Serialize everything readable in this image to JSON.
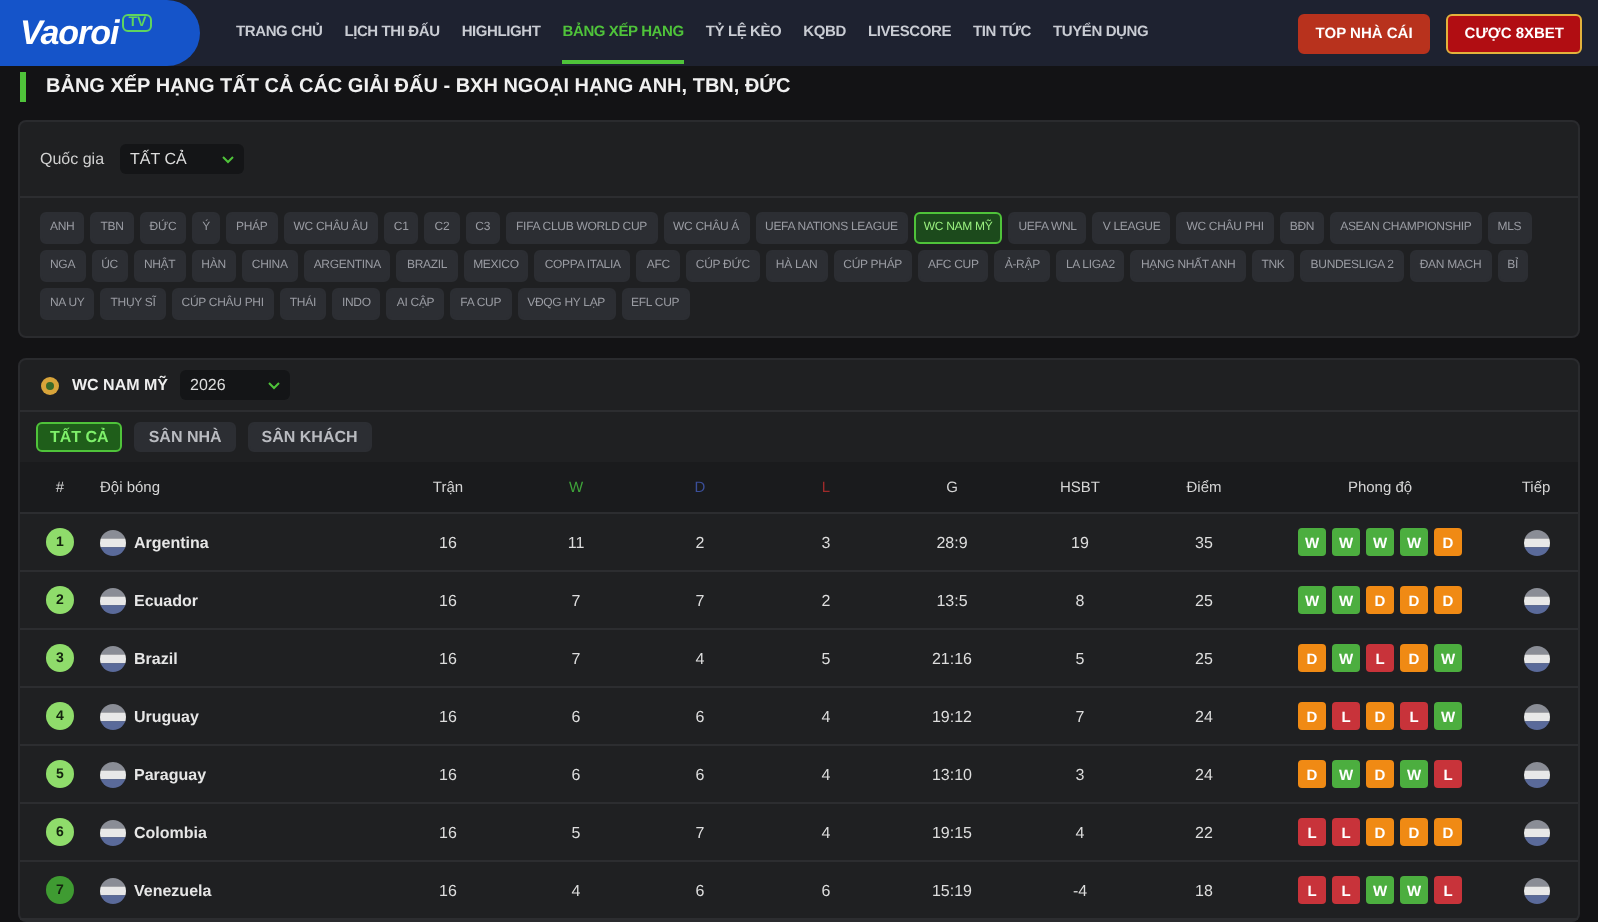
{
  "header": {
    "logo": {
      "text": "Vaoroi",
      "badge": "TV"
    },
    "nav": [
      {
        "label": "TRANG CHỦ",
        "selected": false
      },
      {
        "label": "LỊCH THI ĐẤU",
        "selected": false
      },
      {
        "label": "HIGHLIGHT",
        "selected": false
      },
      {
        "label": "BẢNG XẾP HẠNG",
        "selected": true
      },
      {
        "label": "TỶ LỆ KÈO",
        "selected": false
      },
      {
        "label": "KQBD",
        "selected": false
      },
      {
        "label": "LIVESCORE",
        "selected": false
      },
      {
        "label": "TIN TỨC",
        "selected": false
      },
      {
        "label": "TUYỂN DỤNG",
        "selected": false
      }
    ],
    "buttons": [
      {
        "label": "TOP NHÀ CÁI",
        "kind": "plain"
      },
      {
        "label": "CƯỢC 8XBET",
        "kind": "outlined"
      }
    ]
  },
  "page_title": "BẢNG XẾP HẠNG TẤT CẢ CÁC GIẢI ĐẤU - BXH NGOẠI HẠNG ANH, TBN, ĐỨC",
  "filter": {
    "country_label": "Quốc gia",
    "country_value": "TẤT CẢ",
    "leagues": [
      {
        "label": "ANH",
        "selected": false
      },
      {
        "label": "TBN",
        "selected": false
      },
      {
        "label": "ĐỨC",
        "selected": false
      },
      {
        "label": "Ý",
        "selected": false
      },
      {
        "label": "PHÁP",
        "selected": false
      },
      {
        "label": "WC CHÂU ÂU",
        "selected": false
      },
      {
        "label": "C1",
        "selected": false
      },
      {
        "label": "C2",
        "selected": false
      },
      {
        "label": "C3",
        "selected": false
      },
      {
        "label": "FIFA CLUB WORLD CUP",
        "selected": false
      },
      {
        "label": "WC CHÂU Á",
        "selected": false
      },
      {
        "label": "UEFA NATIONS LEAGUE",
        "selected": false
      },
      {
        "label": "WC NAM MỸ",
        "selected": true
      },
      {
        "label": "UEFA WNL",
        "selected": false
      },
      {
        "label": "V LEAGUE",
        "selected": false
      },
      {
        "label": "WC CHÂU PHI",
        "selected": false
      },
      {
        "label": "BĐN",
        "selected": false
      },
      {
        "label": "ASEAN CHAMPIONSHIP",
        "selected": false
      },
      {
        "label": "MLS",
        "selected": false
      },
      {
        "label": "NGA",
        "selected": false
      },
      {
        "label": "ÚC",
        "selected": false
      },
      {
        "label": "NHẬT",
        "selected": false
      },
      {
        "label": "HÀN",
        "selected": false
      },
      {
        "label": "CHINA",
        "selected": false
      },
      {
        "label": "ARGENTINA",
        "selected": false
      },
      {
        "label": "BRAZIL",
        "selected": false
      },
      {
        "label": "MEXICO",
        "selected": false
      },
      {
        "label": "COPPA ITALIA",
        "selected": false
      },
      {
        "label": "AFC",
        "selected": false
      },
      {
        "label": "CÚP ĐỨC",
        "selected": false
      },
      {
        "label": "HÀ LAN",
        "selected": false
      },
      {
        "label": "CÚP PHÁP",
        "selected": false
      },
      {
        "label": "AFC CUP",
        "selected": false
      },
      {
        "label": "Ả-RẬP",
        "selected": false
      },
      {
        "label": "LA LIGA2",
        "selected": false
      },
      {
        "label": "HẠNG NHẤT ANH",
        "selected": false
      },
      {
        "label": "TNK",
        "selected": false
      },
      {
        "label": "BUNDESLIGA 2",
        "selected": false
      },
      {
        "label": "ĐAN MẠCH",
        "selected": false
      },
      {
        "label": "BỈ",
        "selected": false
      },
      {
        "label": "NA UY",
        "selected": false
      },
      {
        "label": "THỤY SĨ",
        "selected": false
      },
      {
        "label": "CÚP CHÂU PHI",
        "selected": false
      },
      {
        "label": "THÁI",
        "selected": false
      },
      {
        "label": "INDO",
        "selected": false
      },
      {
        "label": "AI CẬP",
        "selected": false
      },
      {
        "label": "FA CUP",
        "selected": false
      },
      {
        "label": "VĐQG HY LẠP",
        "selected": false
      },
      {
        "label": "EFL CUP",
        "selected": false
      }
    ]
  },
  "standings": {
    "league": "WC NAM MỸ",
    "season": "2026",
    "tabs": [
      {
        "label": "TẤT CẢ",
        "selected": true
      },
      {
        "label": "SÂN NHÀ",
        "selected": false
      },
      {
        "label": "SÂN KHÁCH",
        "selected": false
      }
    ],
    "columns": [
      {
        "label": "#",
        "kind": "plain"
      },
      {
        "label": "Đội bóng",
        "kind": "plain"
      },
      {
        "label": "Trận",
        "kind": "plain"
      },
      {
        "label": "W",
        "kind": "win"
      },
      {
        "label": "D",
        "kind": "draw"
      },
      {
        "label": "L",
        "kind": "loss"
      },
      {
        "label": "G",
        "kind": "plain"
      },
      {
        "label": "HSBT",
        "kind": "plain"
      },
      {
        "label": "Điểm",
        "kind": "plain"
      },
      {
        "label": "Phong độ",
        "kind": "plain"
      },
      {
        "label": "Tiếp",
        "kind": "plain"
      }
    ],
    "rows": [
      {
        "rank": "1",
        "kind": "direct",
        "team": "Argentina",
        "played": "16",
        "w": "11",
        "d": "2",
        "l": "3",
        "g": "28:9",
        "gd": "19",
        "pts": "35",
        "form": [
          {
            "label": "W",
            "kind": "win"
          },
          {
            "label": "W",
            "kind": "win"
          },
          {
            "label": "W",
            "kind": "win"
          },
          {
            "label": "W",
            "kind": "win"
          },
          {
            "label": "D",
            "kind": "draw"
          }
        ]
      },
      {
        "rank": "2",
        "kind": "direct",
        "team": "Ecuador",
        "played": "16",
        "w": "7",
        "d": "7",
        "l": "2",
        "g": "13:5",
        "gd": "8",
        "pts": "25",
        "form": [
          {
            "label": "W",
            "kind": "win"
          },
          {
            "label": "W",
            "kind": "win"
          },
          {
            "label": "D",
            "kind": "draw"
          },
          {
            "label": "D",
            "kind": "draw"
          },
          {
            "label": "D",
            "kind": "draw"
          }
        ]
      },
      {
        "rank": "3",
        "kind": "direct",
        "team": "Brazil",
        "played": "16",
        "w": "7",
        "d": "4",
        "l": "5",
        "g": "21:16",
        "gd": "5",
        "pts": "25",
        "form": [
          {
            "label": "D",
            "kind": "draw"
          },
          {
            "label": "W",
            "kind": "win"
          },
          {
            "label": "L",
            "kind": "loss"
          },
          {
            "label": "D",
            "kind": "draw"
          },
          {
            "label": "W",
            "kind": "win"
          }
        ]
      },
      {
        "rank": "4",
        "kind": "direct",
        "team": "Uruguay",
        "played": "16",
        "w": "6",
        "d": "6",
        "l": "4",
        "g": "19:12",
        "gd": "7",
        "pts": "24",
        "form": [
          {
            "label": "D",
            "kind": "draw"
          },
          {
            "label": "L",
            "kind": "loss"
          },
          {
            "label": "D",
            "kind": "draw"
          },
          {
            "label": "L",
            "kind": "loss"
          },
          {
            "label": "W",
            "kind": "win"
          }
        ]
      },
      {
        "rank": "5",
        "kind": "direct",
        "team": "Paraguay",
        "played": "16",
        "w": "6",
        "d": "6",
        "l": "4",
        "g": "13:10",
        "gd": "3",
        "pts": "24",
        "form": [
          {
            "label": "D",
            "kind": "draw"
          },
          {
            "label": "W",
            "kind": "win"
          },
          {
            "label": "D",
            "kind": "draw"
          },
          {
            "label": "W",
            "kind": "win"
          },
          {
            "label": "L",
            "kind": "loss"
          }
        ]
      },
      {
        "rank": "6",
        "kind": "direct",
        "team": "Colombia",
        "played": "16",
        "w": "5",
        "d": "7",
        "l": "4",
        "g": "19:15",
        "gd": "4",
        "pts": "22",
        "form": [
          {
            "label": "L",
            "kind": "loss"
          },
          {
            "label": "L",
            "kind": "loss"
          },
          {
            "label": "D",
            "kind": "draw"
          },
          {
            "label": "D",
            "kind": "draw"
          },
          {
            "label": "D",
            "kind": "draw"
          }
        ]
      },
      {
        "rank": "7",
        "kind": "playoff",
        "team": "Venezuela",
        "played": "16",
        "w": "4",
        "d": "6",
        "l": "6",
        "g": "15:19",
        "gd": "-4",
        "pts": "18",
        "form": [
          {
            "label": "L",
            "kind": "loss"
          },
          {
            "label": "L",
            "kind": "loss"
          },
          {
            "label": "W",
            "kind": "win"
          },
          {
            "label": "W",
            "kind": "win"
          },
          {
            "label": "L",
            "kind": "loss"
          }
        ]
      }
    ]
  }
}
